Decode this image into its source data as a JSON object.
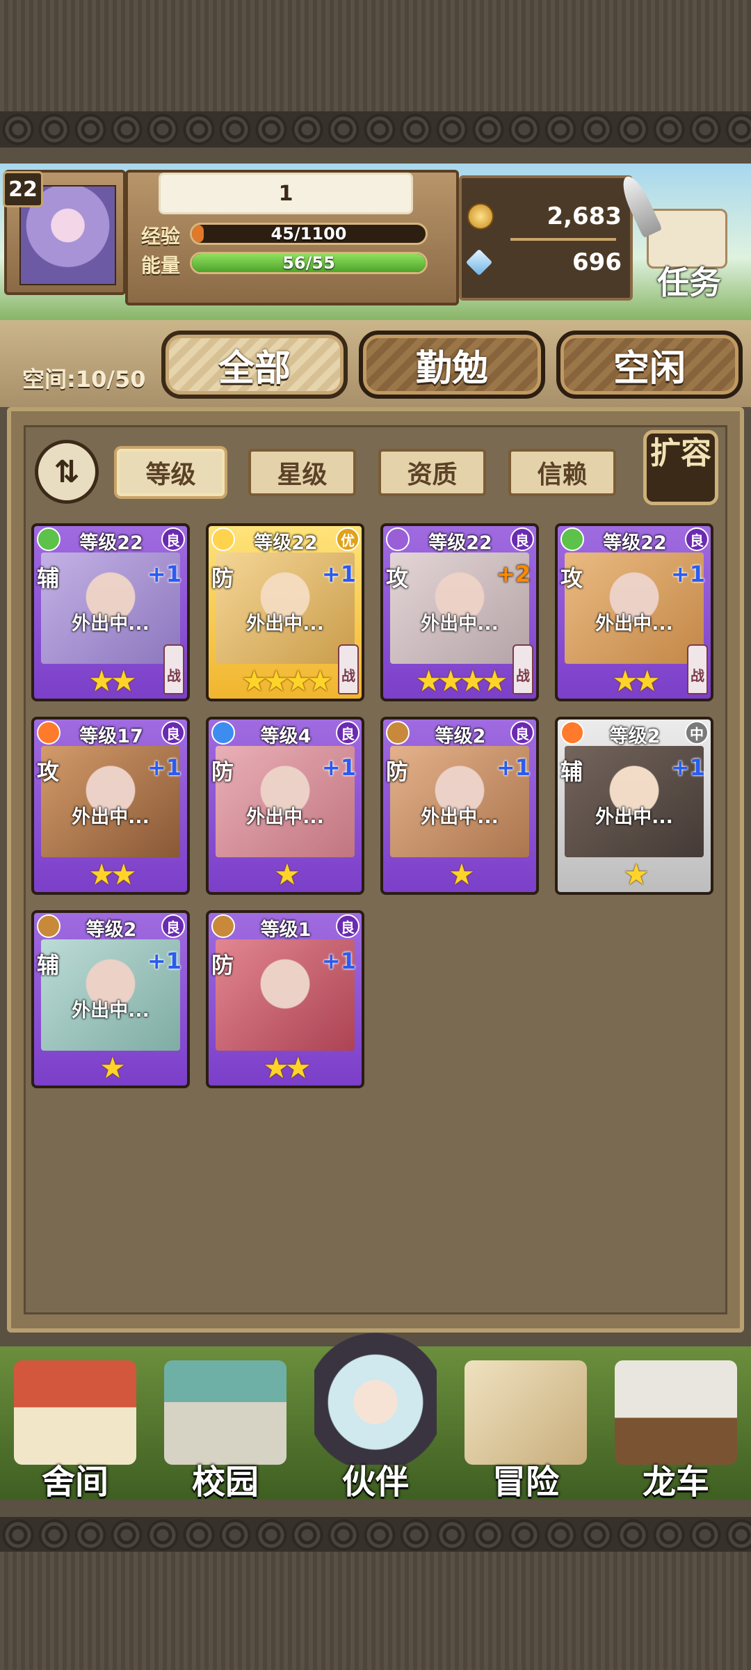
{
  "player": {
    "level": "22",
    "name": "1"
  },
  "stats": {
    "exp_label": "经验",
    "exp_text": "45/1100",
    "exp_fraction": 0.041,
    "energy_label": "能量",
    "energy_text": "56/55",
    "energy_fraction": 1.0
  },
  "resources": {
    "gold": "2,683",
    "gems": "696"
  },
  "task_button": "任务",
  "space": "空间:10/50",
  "tabs": [
    {
      "label": "全部",
      "active": true
    },
    {
      "label": "勤勉",
      "active": false
    },
    {
      "label": "空闲",
      "active": false
    }
  ],
  "filters": [
    {
      "label": "等级",
      "active": true
    },
    {
      "label": "星级",
      "active": false
    },
    {
      "label": "资质",
      "active": false
    },
    {
      "label": "信赖",
      "active": false
    }
  ],
  "expand_button": "扩容",
  "cards": [
    {
      "level": "等级22",
      "rarity": "良",
      "role": "辅",
      "plus": "+1",
      "status": "外出中...",
      "stars": 2,
      "battle": "战",
      "frame": "purple",
      "element": "leaf"
    },
    {
      "level": "等级22",
      "rarity": "优",
      "role": "防",
      "plus": "+1",
      "status": "外出中...",
      "stars": 4,
      "battle": "战",
      "frame": "gold",
      "element": "light"
    },
    {
      "level": "等级22",
      "rarity": "良",
      "role": "攻",
      "plus": "+2",
      "status": "外出中...",
      "stars": 4,
      "battle": "战",
      "frame": "purple",
      "element": "dark"
    },
    {
      "level": "等级22",
      "rarity": "良",
      "role": "攻",
      "plus": "+1",
      "status": "外出中...",
      "stars": 2,
      "battle": "战",
      "frame": "purple",
      "element": "leaf"
    },
    {
      "level": "等级17",
      "rarity": "良",
      "role": "攻",
      "plus": "+1",
      "status": "外出中...",
      "stars": 2,
      "battle": "",
      "frame": "purple",
      "element": "fire"
    },
    {
      "level": "等级4",
      "rarity": "良",
      "role": "防",
      "plus": "+1",
      "status": "外出中...",
      "stars": 1,
      "battle": "",
      "frame": "purple",
      "element": "water"
    },
    {
      "level": "等级2",
      "rarity": "良",
      "role": "防",
      "plus": "+1",
      "status": "外出中...",
      "stars": 1,
      "battle": "",
      "frame": "purple",
      "element": "earth"
    },
    {
      "level": "等级2",
      "rarity": "中",
      "role": "辅",
      "plus": "+1",
      "status": "外出中...",
      "stars": 1,
      "battle": "",
      "frame": "gray",
      "element": "fire"
    },
    {
      "level": "等级2",
      "rarity": "良",
      "role": "辅",
      "plus": "+1",
      "status": "外出中...",
      "stars": 1,
      "battle": "",
      "frame": "purple",
      "element": "earth"
    },
    {
      "level": "等级1",
      "rarity": "良",
      "role": "防",
      "plus": "+1",
      "status": "",
      "stars": 2,
      "battle": "",
      "frame": "purple",
      "element": "earth"
    }
  ],
  "nav": [
    {
      "label": "舍间",
      "icon": "house-icon"
    },
    {
      "label": "校园",
      "icon": "school-icon"
    },
    {
      "label": "伙伴",
      "icon": "witch-partner-icon"
    },
    {
      "label": "冒险",
      "icon": "adventure-map-icon"
    },
    {
      "label": "龙车",
      "icon": "dragon-wagon-icon"
    }
  ],
  "colors": {
    "gold": "#f1b52f",
    "purple": "#8a4fd6",
    "exp": "#e07a2a",
    "energy": "#62b83b"
  }
}
